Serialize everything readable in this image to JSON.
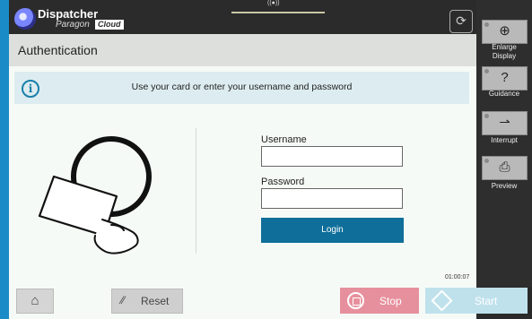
{
  "app": {
    "brand_name": "Dispatcher",
    "brand_sub": "Paragon",
    "brand_badge": "Cloud",
    "top_strip_label": "((●))"
  },
  "header": {
    "title": "Authentication"
  },
  "info": {
    "message": "Use your card or enter your username and password"
  },
  "form": {
    "username_label": "Username",
    "username_value": "",
    "password_label": "Password",
    "password_value": "",
    "login_label": "Login"
  },
  "timer": "01:00:07",
  "bottom": {
    "reset_label": "Reset",
    "stop_label": "Stop",
    "start_label": "Start"
  },
  "side": {
    "enlarge_label_1": "Enlarge",
    "enlarge_label_2": "Display",
    "guidance_label": "Guidance",
    "interrupt_label": "Interrupt",
    "preview_label": "Preview"
  },
  "icons": {
    "logo": "dispatcher-logo",
    "card": "card-swipe-icon",
    "info": "info-icon",
    "home": "home-icon",
    "reset": "reset-icon",
    "stop": "stop-icon",
    "start": "start-icon",
    "enlarge": "zoom-in-icon",
    "guidance": "question-icon",
    "interrupt": "interrupt-icon",
    "preview": "preview-icon"
  },
  "colors": {
    "accent": "#0f6f9a",
    "frame": "#1a8bc6",
    "stop": "#e7909d",
    "start": "#bfe1ec"
  }
}
